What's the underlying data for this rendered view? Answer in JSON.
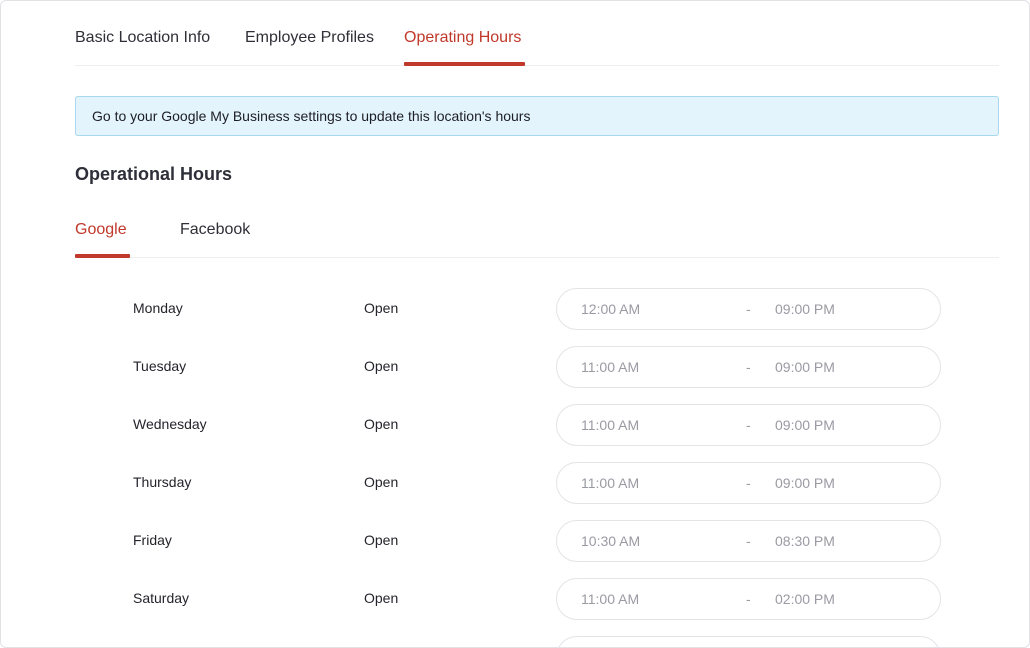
{
  "tabs": {
    "basic_info": "Basic Location Info",
    "employee_profiles": "Employee Profiles",
    "operating_hours": "Operating Hours",
    "active": "operating_hours"
  },
  "banner": {
    "text": "Go to your Google My Business settings to update this location's hours"
  },
  "section": {
    "title": "Operational Hours"
  },
  "platform_tabs": {
    "google": "Google",
    "facebook": "Facebook",
    "active": "google"
  },
  "hours": [
    {
      "day": "Monday",
      "status": "Open",
      "start": "12:00 AM",
      "sep": "-",
      "end": "09:00 PM"
    },
    {
      "day": "Tuesday",
      "status": "Open",
      "start": "11:00 AM",
      "sep": "-",
      "end": "09:00 PM"
    },
    {
      "day": "Wednesday",
      "status": "Open",
      "start": "11:00 AM",
      "sep": "-",
      "end": "09:00 PM"
    },
    {
      "day": "Thursday",
      "status": "Open",
      "start": "11:00 AM",
      "sep": "-",
      "end": "09:00 PM"
    },
    {
      "day": "Friday",
      "status": "Open",
      "start": "10:30 AM",
      "sep": "-",
      "end": "08:30 PM"
    },
    {
      "day": "Saturday",
      "status": "Open",
      "start": "11:00 AM",
      "sep": "-",
      "end": "02:00 PM"
    }
  ],
  "colors": {
    "accent": "#c0392b",
    "banner_bg": "#e3f4fc",
    "banner_border": "#a8d8ef"
  }
}
